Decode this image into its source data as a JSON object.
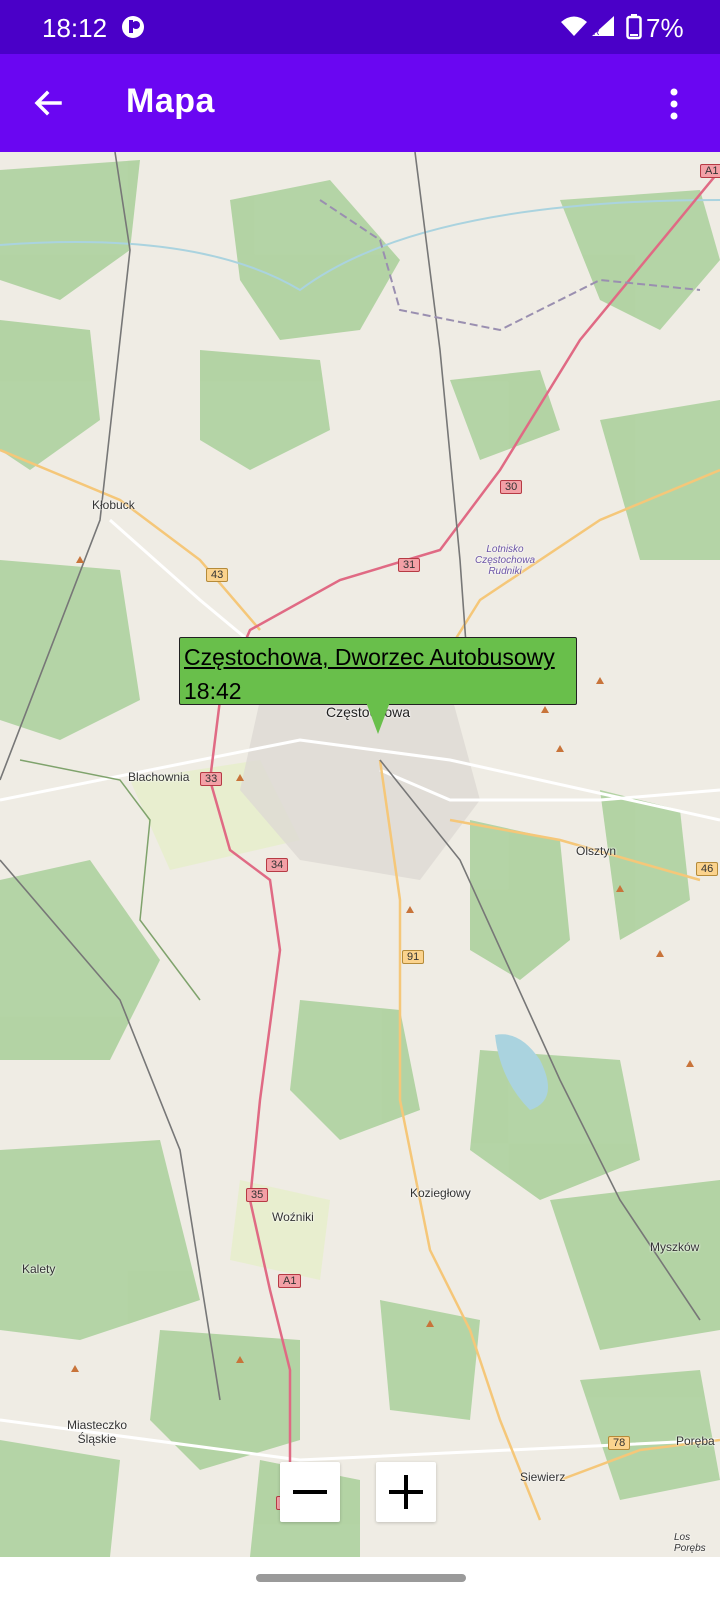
{
  "status_bar": {
    "time": "18:12",
    "battery": "7%",
    "icons": [
      "notification-app-icon",
      "wifi-icon",
      "signal-icon",
      "battery-icon"
    ]
  },
  "app_bar": {
    "title": "Mapa",
    "back_icon": "arrow-left-icon",
    "menu_icon": "more-vert-icon"
  },
  "map": {
    "popup": {
      "stop_name": "Częstochowa, Dworzec Autobusowy",
      "time": "18:42"
    },
    "places": [
      "Kłobuck",
      "Lotnisko Częstochowa Rudniki",
      "Częstochowa",
      "Blachownia",
      "Olsztyn",
      "Koziegłowy",
      "Woźniki",
      "Kalety",
      "Myszków",
      "Miasteczko Śląskie",
      "Siewierz",
      "Poręba",
      "Los Porębs"
    ],
    "road_numbers": [
      "43",
      "31",
      "30",
      "33",
      "34",
      "91",
      "35",
      "A1",
      "46",
      "78",
      "36",
      "A1"
    ],
    "colors": {
      "forest": "#add19e",
      "motorway": "#e892a2",
      "primary": "#fcd6a4",
      "water": "#aad3df",
      "popup": "#69bf4b"
    }
  },
  "zoom": {
    "minus": "−",
    "plus": "+"
  }
}
